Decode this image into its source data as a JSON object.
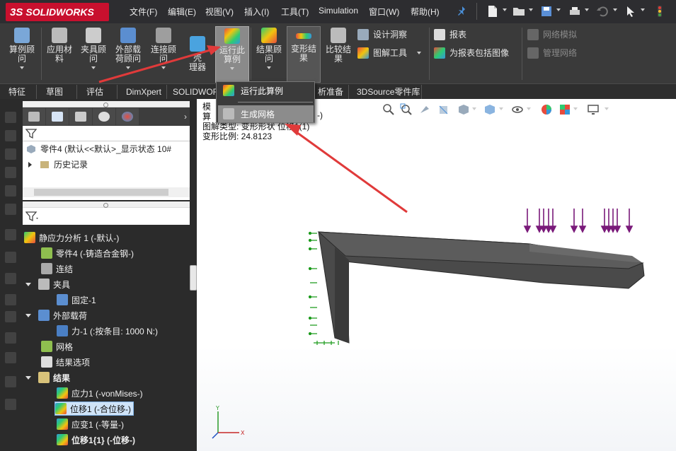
{
  "app": {
    "logo_prefix": "3S",
    "logo_text": "SOLIDWORKS"
  },
  "menu": [
    "文件(F)",
    "编辑(E)",
    "视图(V)",
    "插入(I)",
    "工具(T)",
    "Simulation",
    "窗口(W)",
    "帮助(H)"
  ],
  "ribbon": {
    "buttons": [
      {
        "label1": "算例顾",
        "label2": "问",
        "color": "#7aa7d8"
      },
      {
        "label1": "应用材",
        "label2": "料",
        "color": "#bbbbbb"
      },
      {
        "label1": "夹具顾",
        "label2": "问",
        "color": "#cccccc"
      },
      {
        "label1": "外部载",
        "label2": "荷顾问",
        "color": "#5b8ed0"
      },
      {
        "label1": "连接顾",
        "label2": "问",
        "color": "#9e9e9e"
      },
      {
        "label1": "壳",
        "label2": "理器",
        "color": "#4aa3df"
      },
      {
        "label1": "运行此",
        "label2": "算例",
        "color": "#3fbf4f"
      },
      {
        "label1": "结果顾",
        "label2": "问",
        "color": "#4bc26a"
      },
      {
        "label1": "变形结",
        "label2": "果",
        "color": "#d9d9d9"
      },
      {
        "label1": "比较结",
        "label2": "果",
        "color": "#bbbbbb"
      }
    ],
    "small": {
      "design_insight": "设计洞察",
      "plot_tools": "图解工具",
      "report": "报表",
      "include_image": "为报表包括图像",
      "mesh_sim": "网络模拟",
      "manage_net": "管理网络"
    }
  },
  "tabs": [
    "特征",
    "草图",
    "评估",
    "DimXpert",
    "SOLIDWORK",
    "析准备",
    "3DSource零件库"
  ],
  "popup": {
    "run_study": "运行此算例",
    "create_mesh": "生成网格"
  },
  "feature_manager": {
    "part_line": "零件4  (默认<<默认>_显示状态 10#",
    "history": "历史记录"
  },
  "study_tree": {
    "study": "静应力分析 1 (-默认-)",
    "part": "零件4 (-铸造合金钢-)",
    "connections": "连结",
    "fixtures": "夹具",
    "fixed": "固定-1",
    "loads": "外部载荷",
    "force": "力-1 (:按条目: 1000 N:)",
    "mesh": "网格",
    "result_options": "结果选项",
    "results": "结果",
    "stress": "应力1 (-vonMises-)",
    "displacement": "位移1 (-合位移-)",
    "strain": "应变1 (-等量-)",
    "displacement2": "位移1{1} (-位移-)"
  },
  "viewport": {
    "info_lines": [
      "模",
      "算",
      "图解类型: 变形形状 位移1(1)",
      "变形比例: 24.8123"
    ],
    "info_suffix": "-)"
  },
  "colors": {
    "accent_red": "#e03a3a",
    "load_arrow": "#7a1a7a",
    "fixture": "#1a9a1a"
  }
}
